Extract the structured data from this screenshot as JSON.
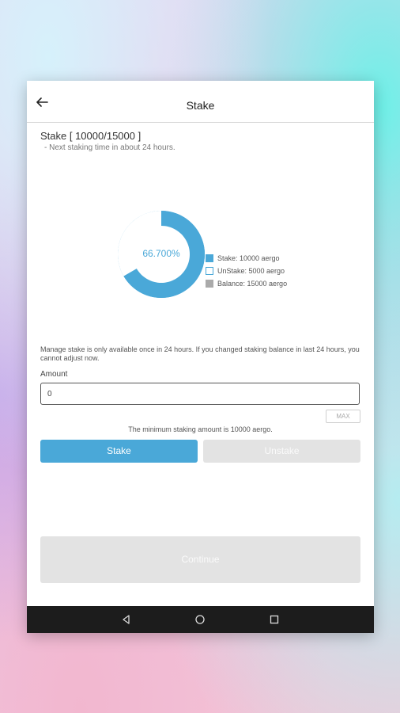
{
  "appbar": {
    "title": "Stake",
    "back_icon": "arrow-left-icon"
  },
  "stake": {
    "title": "Stake [ 10000/15000 ]",
    "subtitle": "- Next staking time in about 24 hours."
  },
  "chart_data": {
    "type": "pie",
    "center_label": "66.700%",
    "slices": [
      {
        "label": "Stake: 10000 aergo",
        "value": 10000,
        "color": "#4aa8d8"
      },
      {
        "label": "UnStake: 5000 aergo",
        "value": 5000,
        "color": "#ffffff"
      }
    ],
    "legend": [
      {
        "label": "Stake: 10000 aergo",
        "color": "#4aa8d8",
        "style": "filled"
      },
      {
        "label": "UnStake: 5000 aergo",
        "color": "#4aa8d8",
        "style": "outline"
      },
      {
        "label": "Balance: 15000 aergo",
        "color": "#aaaaaa",
        "style": "filled"
      }
    ],
    "legend_position": "right"
  },
  "notice": "Manage stake is only available once in 24 hours. If you changed staking balance in last 24 hours, you cannot adjust now.",
  "amount": {
    "label": "Amount",
    "value": "0",
    "max_label": "MAX"
  },
  "min_note": "The minimum staking amount is 10000 aergo.",
  "buttons": {
    "stake": "Stake",
    "unstake": "Unstake",
    "continue": "Continue"
  },
  "colors": {
    "accent": "#4aa8d8",
    "disabled": "#e3e3e3",
    "navbar": "#1c1c1c"
  },
  "navbar": {
    "icons": [
      "back-triangle-icon",
      "home-circle-icon",
      "recents-square-icon"
    ]
  }
}
